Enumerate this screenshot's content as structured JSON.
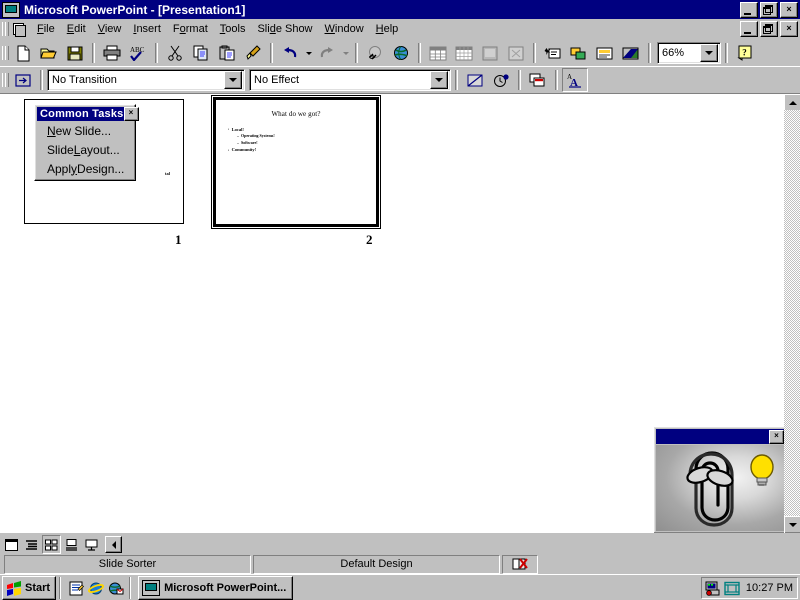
{
  "titlebar": {
    "text": "Microsoft PowerPoint - [Presentation1]",
    "icon": "powerpoint-icon",
    "minimize": "_",
    "restore": "❐",
    "close": "×"
  },
  "menubar": {
    "items": [
      {
        "label": "File",
        "accel": "F"
      },
      {
        "label": "Edit",
        "accel": "E"
      },
      {
        "label": "View",
        "accel": "V"
      },
      {
        "label": "Insert",
        "accel": "I"
      },
      {
        "label": "Format",
        "accel": "o"
      },
      {
        "label": "Tools",
        "accel": "T"
      },
      {
        "label": "Slide Show",
        "accel": "d"
      },
      {
        "label": "Window",
        "accel": "W"
      },
      {
        "label": "Help",
        "accel": "H"
      }
    ],
    "minimize": "_",
    "restore": "❐",
    "close": "×"
  },
  "toolbar_standard": {
    "buttons": [
      "new-document-icon",
      "open-folder-icon",
      "save-disk-icon",
      "print-icon",
      "spelling-check-icon",
      "cut-scissors-icon",
      "copy-icon",
      "paste-icon",
      "format-painter-icon",
      "undo-arrow-icon",
      "redo-arrow-icon",
      "insert-hyperlink-icon",
      "web-toolbar-globe-icon",
      "insert-table-icon",
      "insert-excel-table-icon",
      "insert-clipart-icon",
      "picture-effects-icon",
      "animation-effects-icon",
      "expand-collapse-icon",
      "black-white-view-icon",
      "gradient-icon"
    ],
    "zoom_value": "66%",
    "help_label": "?"
  },
  "toolbar_sorter": {
    "slide_transition_icon": "slide-transition-icon",
    "transition_value": "No Transition",
    "effect_value": "No Effect",
    "hide_slide_icon": "hide-slide-icon",
    "rehearse_timings_icon": "rehearse-timings-clock-icon",
    "summary_slide_icon": "summary-slide-icon",
    "speaker_notes_icon": "speaker-notes-icon"
  },
  "common_tasks": {
    "title": "Common Tasks",
    "close": "×",
    "items": [
      {
        "pre": "",
        "accel": "N",
        "post": "ew Slide..."
      },
      {
        "pre": "Slide ",
        "accel": "L",
        "post": "ayout..."
      },
      {
        "pre": "Appl",
        "accel": "y",
        "post": " Design..."
      }
    ]
  },
  "slides": [
    {
      "number": "1",
      "selected": false,
      "title": "",
      "bullets": [],
      "visible_fragment": "tal"
    },
    {
      "number": "2",
      "selected": true,
      "title": "What do we got?",
      "bullets": [
        {
          "level": 1,
          "text": "Local!"
        },
        {
          "level": 2,
          "text": "Operating Systems!"
        },
        {
          "level": 2,
          "text": "Software!"
        },
        {
          "level": 1,
          "text": "Community!"
        }
      ],
      "visible_fragment": ""
    }
  ],
  "assistant": {
    "name": "office-assistant-clippy",
    "close": "×",
    "tip_indicator": "lightbulb-icon"
  },
  "statusbar": {
    "view_buttons": [
      "normal-view-icon",
      "outline-view-icon",
      "slide-sorter-view-icon",
      "notes-page-view-icon",
      "slide-show-view-icon"
    ],
    "active_view_index": 2,
    "scroll_left_icon": "scroll-left-arrow-icon",
    "view_label": "Slide Sorter",
    "design_label": "Default Design",
    "spelling_status_icon": "spelling-error-icon"
  },
  "taskbar": {
    "start_label": "Start",
    "start_icon": "windows-flag-icon",
    "quick_launch": [
      "show-desktop-icon",
      "internet-explorer-icon",
      "outlook-express-icon"
    ],
    "tasks": [
      {
        "icon": "powerpoint-icon",
        "label": "Microsoft PowerPoint..."
      }
    ],
    "tray_icons": [
      "network-connection-icon",
      "display-settings-icon"
    ],
    "clock": "10:27 PM"
  },
  "scrollbar": {
    "up_arrow": "scroll-up-arrow-icon",
    "down_arrow": "scroll-down-arrow-icon"
  },
  "colors": {
    "titlebar_active": "#000080",
    "face": "#c0c0c0",
    "workspace": "#ffffff",
    "highlight": "#ffffff",
    "shadow": "#808080"
  }
}
